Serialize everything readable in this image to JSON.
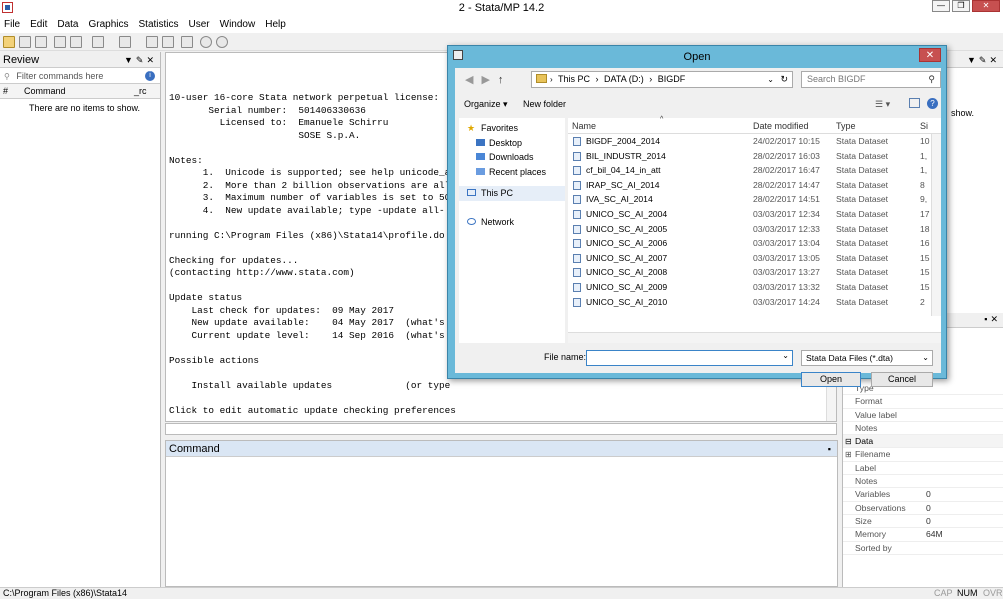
{
  "window": {
    "title": "2 - Stata/MP 14.2",
    "min": "—",
    "max": "❐",
    "close": "✕"
  },
  "menu": [
    "File",
    "Edit",
    "Data",
    "Graphics",
    "Statistics",
    "User",
    "Window",
    "Help"
  ],
  "review": {
    "title": "Review",
    "filter_placeholder": "Filter commands here",
    "col_hash": "#",
    "col_command": "Command",
    "col_rc": "_rc",
    "empty": "There are no items to show."
  },
  "results": {
    "lines": [
      "10-user 16-core Stata network perpetual license:",
      "       Serial number:  501406330636",
      "         Licensed to:  Emanuele Schirru",
      "                       SOSE S.p.A.",
      "",
      "Notes:",
      "      1.  Unicode is supported; see help unicode_a",
      "      2.  More than 2 billion observations are all",
      "      3.  Maximum number of variables is set to 50",
      "      4.  New update available; type -update all-",
      "",
      "running C:\\Program Files (x86)\\Stata14\\profile.do",
      "",
      "Checking for updates...",
      "(contacting http://www.stata.com)",
      "",
      "Update status",
      "    Last check for updates:  09 May 2017",
      "    New update available:    04 May 2017  (what's",
      "    Current update level:    14 Sep 2016  (what's",
      "",
      "Possible actions",
      "",
      "    Install available updates             (or type",
      "",
      "Click to edit automatic update checking preferences",
      "",
      "."
    ]
  },
  "command": {
    "title": "Command"
  },
  "properties": {
    "variables_rows": [
      {
        "k": "Type",
        "v": ""
      },
      {
        "k": "Format",
        "v": ""
      },
      {
        "k": "Value label",
        "v": ""
      },
      {
        "k": "Notes",
        "v": ""
      }
    ],
    "data_header": "Data",
    "data_rows": [
      {
        "k": "Filename",
        "v": ""
      },
      {
        "k": "Label",
        "v": ""
      },
      {
        "k": "Notes",
        "v": ""
      },
      {
        "k": "Variables",
        "v": "0"
      },
      {
        "k": "Observations",
        "v": "0"
      },
      {
        "k": "Size",
        "v": "0"
      },
      {
        "k": "Memory",
        "v": "64M"
      },
      {
        "k": "Sorted by",
        "v": ""
      }
    ],
    "variables_panel_fragment": "show."
  },
  "status": {
    "path": "C:\\Program Files (x86)\\Stata14",
    "cap": "CAP",
    "num": "NUM",
    "ovr": "OVR"
  },
  "dialog": {
    "title": "Open",
    "close": "✕",
    "breadcrumb": [
      "This PC",
      "DATA (D:)",
      "BIGDF"
    ],
    "search_placeholder": "Search BIGDF",
    "organize": "Organize",
    "new_folder": "New folder",
    "nav": {
      "favorites": "Favorites",
      "fav_items": [
        "Desktop",
        "Downloads",
        "Recent places"
      ],
      "this_pc": "This PC",
      "network": "Network"
    },
    "columns": {
      "name": "Name",
      "date": "Date modified",
      "type": "Type",
      "size": "Si"
    },
    "files": [
      {
        "name": "BIGDF_2004_2014",
        "date": "24/02/2017 10:15",
        "type": "Stata Dataset",
        "size": "10"
      },
      {
        "name": "BIL_INDUSTR_2014",
        "date": "28/02/2017 16:03",
        "type": "Stata Dataset",
        "size": "1,"
      },
      {
        "name": "cf_bil_04_14_in_att",
        "date": "28/02/2017 16:47",
        "type": "Stata Dataset",
        "size": "1,"
      },
      {
        "name": "IRAP_SC_AI_2014",
        "date": "28/02/2017 14:47",
        "type": "Stata Dataset",
        "size": "8"
      },
      {
        "name": "IVA_SC_AI_2014",
        "date": "28/02/2017 14:51",
        "type": "Stata Dataset",
        "size": "9,"
      },
      {
        "name": "UNICO_SC_AI_2004",
        "date": "03/03/2017 12:34",
        "type": "Stata Dataset",
        "size": "17"
      },
      {
        "name": "UNICO_SC_AI_2005",
        "date": "03/03/2017 12:33",
        "type": "Stata Dataset",
        "size": "18"
      },
      {
        "name": "UNICO_SC_AI_2006",
        "date": "03/03/2017 13:04",
        "type": "Stata Dataset",
        "size": "16"
      },
      {
        "name": "UNICO_SC_AI_2007",
        "date": "03/03/2017 13:05",
        "type": "Stata Dataset",
        "size": "15"
      },
      {
        "name": "UNICO_SC_AI_2008",
        "date": "03/03/2017 13:27",
        "type": "Stata Dataset",
        "size": "15"
      },
      {
        "name": "UNICO_SC_AI_2009",
        "date": "03/03/2017 13:32",
        "type": "Stata Dataset",
        "size": "15"
      },
      {
        "name": "UNICO_SC_AI_2010",
        "date": "03/03/2017 14:24",
        "type": "Stata Dataset",
        "size": "2"
      }
    ],
    "file_name_label": "File name:",
    "file_name_value": "",
    "file_type": "Stata Data Files (*.dta)",
    "open": "Open",
    "cancel": "Cancel"
  }
}
